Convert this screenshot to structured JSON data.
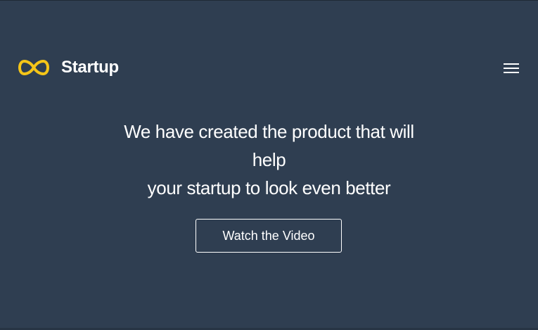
{
  "brand": {
    "name": "Startup",
    "icon": "infinity-icon",
    "icon_color": "#f5c518"
  },
  "nav": {
    "menu_icon": "hamburger-menu-icon"
  },
  "hero": {
    "headline_lines": [
      "We have created the product that will",
      "help",
      "your startup to look even better"
    ],
    "cta_label": "Watch the Video"
  },
  "colors": {
    "background": "#2f3e51",
    "text": "#ffffff",
    "accent": "#f5c518"
  }
}
